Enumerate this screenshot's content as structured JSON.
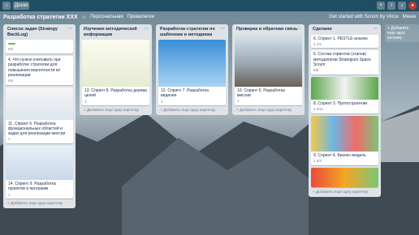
{
  "header": {
    "boards_label": "Доски"
  },
  "board": {
    "title": "Разработка стратегии XXX",
    "visibility": "Персональная",
    "privileges": "Привилегии",
    "tail": "Get started with Scrum by Vince",
    "menu": "Меню"
  },
  "lists": [
    {
      "title": "Список задач (Strategy BackLog)",
      "cards": [
        {
          "text": "",
          "meta": "0/4"
        },
        {
          "text": "4. Что нужно учитывать при разработке стратегии для повышения вероятности её реализации",
          "meta": "0/4"
        },
        {
          "text": "11. Спринт 6. Разработка функциональных областей и задач для реализации миссии",
          "meta": "1"
        },
        {
          "text": "14. Спринт 9. Разработка проектов и программ",
          "meta": "1"
        }
      ],
      "add": "+ Добавить еще одну карточку"
    },
    {
      "title": "Изучение методической информации",
      "cards": [
        {
          "text": "13. Спринт 8. Разработка дерева целей",
          "meta": "1"
        }
      ],
      "add": "+ Добавить еще одну карточку"
    },
    {
      "title": "Разработка стратегии по шаблонам и методикам",
      "cards": [
        {
          "text": "12. Спринт 7. Разработка видения",
          "meta": "1"
        }
      ],
      "add": "+ Добавить еще одну карточку"
    },
    {
      "title": "Проверка и обратная связь",
      "cards": [
        {
          "text": "10. Спринт 5. Разработка миссии",
          "meta": "1"
        }
      ],
      "add": "+ Добавить еще одну карточку"
    },
    {
      "title": "Сделано",
      "cards": [
        {
          "text": "6. Спринт 1. PESTLE-анализ",
          "meta": "1  1/1"
        },
        {
          "text": "5. Состав спринтов (этапов) методологии Strategium Space Scrum",
          "meta": "5/5"
        },
        {
          "text": "8. Спринт 3. Протостратегии",
          "meta": "1  2/11"
        },
        {
          "text": "9. Спринт 4. Бизнес-модель",
          "meta": "1  2/2"
        }
      ],
      "add": "+ Добавить еще одну карточку"
    }
  ],
  "add_list": "+ Добавить еще одну колонку"
}
